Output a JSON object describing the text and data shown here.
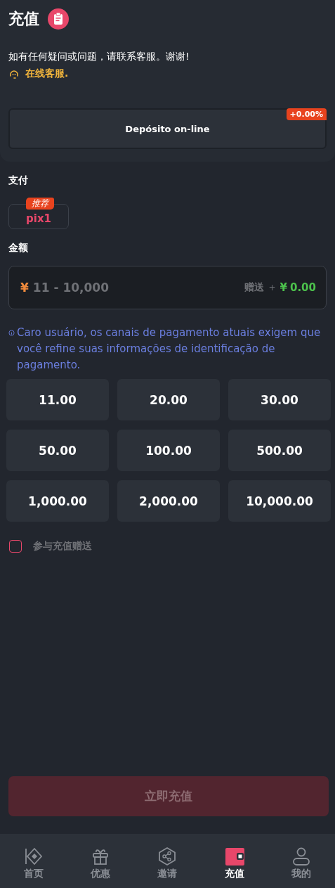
{
  "header": {
    "title": "充值"
  },
  "notice": {
    "text": "如有任何疑问或问题，请联系客服。谢谢!",
    "link": "在线客服."
  },
  "deposit_tabs": [
    {
      "label": "Depósito on-line",
      "badge": "+0.00%",
      "selected": true
    }
  ],
  "payment": {
    "label": "支付",
    "methods": [
      {
        "label": "pix1",
        "badge": "推荐",
        "selected": true
      }
    ]
  },
  "amount": {
    "label": "金额",
    "currency": "¥",
    "placeholder": "11 - 10,000",
    "bonus_label": "赠送",
    "bonus_plus": "+",
    "bonus_currency": "¥",
    "bonus_value": "0.00"
  },
  "hint": "Caro usuário, os canais de pagamento atuais exigem que você refine suas informações de identificação de pagamento.",
  "amount_options": [
    {
      "label": "11.00",
      "selected": false
    },
    {
      "label": "20.00",
      "selected": false
    },
    {
      "label": "30.00",
      "selected": false
    },
    {
      "label": "50.00",
      "selected": false
    },
    {
      "label": "100.00",
      "selected": false
    },
    {
      "label": "500.00",
      "selected": false
    },
    {
      "label": "1,000.00",
      "selected": false
    },
    {
      "label": "2,000.00",
      "selected": false
    },
    {
      "label": "10,000.00",
      "selected": false
    }
  ],
  "bonus_checkbox": {
    "label": "参与充值赠送",
    "checked": false
  },
  "submit": {
    "label": "立即充值",
    "disabled": true
  },
  "bottom_nav": [
    {
      "label": "首页",
      "kind": "home",
      "selected": false
    },
    {
      "label": "优惠",
      "kind": "gift",
      "selected": false
    },
    {
      "label": "邀请",
      "kind": "share",
      "selected": false
    },
    {
      "label": "充值",
      "kind": "wallet",
      "selected": true
    },
    {
      "label": "我的",
      "kind": "user",
      "selected": false
    }
  ]
}
